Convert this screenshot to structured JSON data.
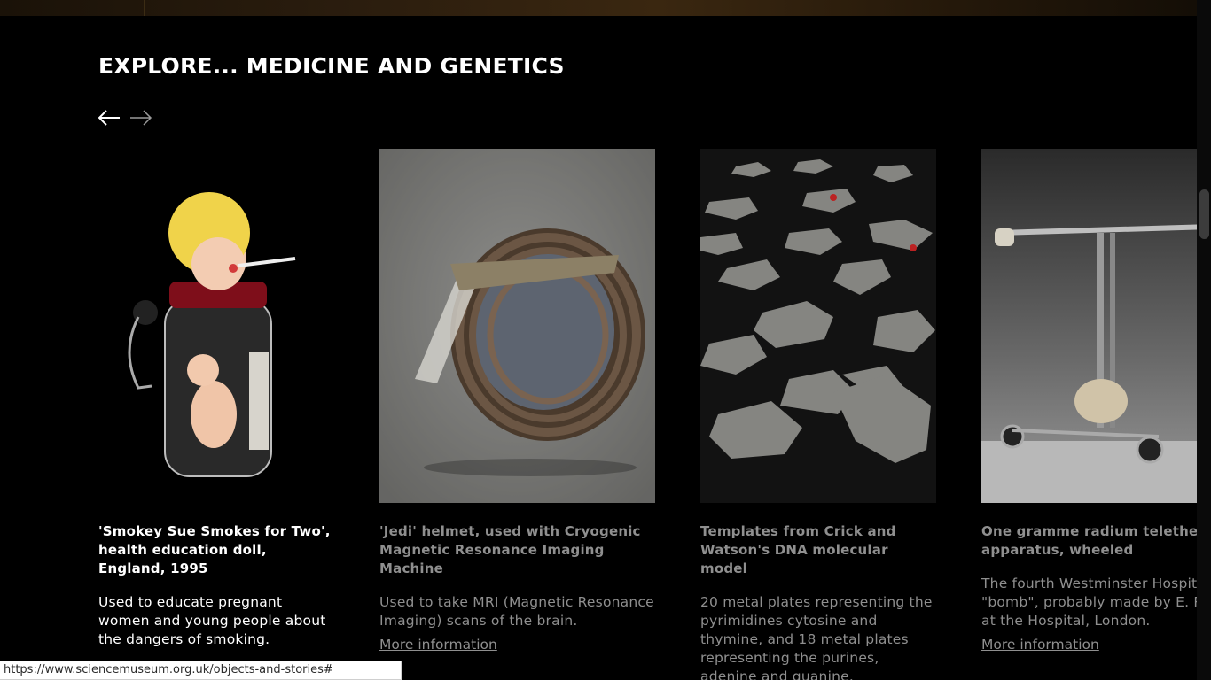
{
  "section": {
    "title": "EXPLORE... MEDICINE AND GENETICS"
  },
  "nav": {
    "prev_icon": "arrow-left-icon",
    "next_icon": "arrow-right-icon"
  },
  "cards": [
    {
      "title": "'Smokey Sue Smokes for Two', health education doll, England, 1995",
      "description": "Used to educate pregnant women and young people about the dangers of smoking.",
      "image": "smoking-doll-image"
    },
    {
      "title": "'Jedi' helmet, used with Cryogenic Magnetic Resonance Imaging Machine",
      "description": "Used to take MRI (Magnetic Resonance Imaging) scans of the brain.",
      "link": "More information",
      "image": "mri-helmet-image"
    },
    {
      "title": "Templates from Crick and Watson's DNA molecular model",
      "description": "20 metal plates representing the pyrimidines cytosine and thymine, and 18 metal plates representing the purines, adenine and guanine.",
      "image": "dna-templates-image"
    },
    {
      "title": "One gramme radium teletherapy apparatus, wheeled",
      "description": "The fourth Westminster Hospital \"bomb\", probably made by E. R. Carling at the Hospital, London.",
      "link": "More information",
      "image": "radium-apparatus-image"
    }
  ],
  "status_bar": {
    "url": "https://www.sciencemuseum.org.uk/objects-and-stories#"
  },
  "colors": {
    "background": "#000000",
    "text_primary": "#ffffff",
    "text_dim": "#8f8f8f"
  }
}
